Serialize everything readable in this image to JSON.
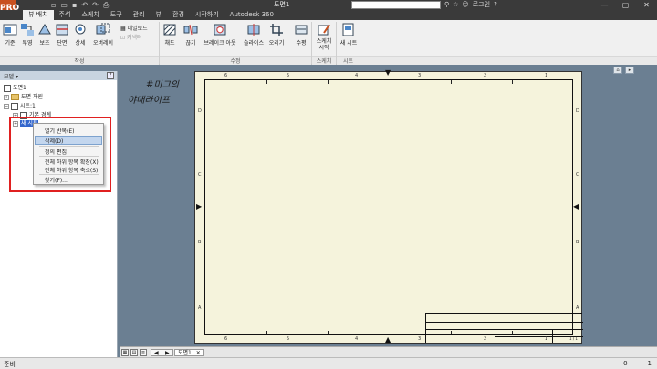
{
  "titlebar": {
    "app_logo": "PRO",
    "doc_title": "도면1",
    "signin": "로그인",
    "help": "?",
    "minimize": "—",
    "maximize": "▢",
    "close": "✕"
  },
  "tabs": [
    {
      "label": "뷰 배치",
      "active": true
    },
    {
      "label": "주석"
    },
    {
      "label": "스케치"
    },
    {
      "label": "도구"
    },
    {
      "label": "관리"
    },
    {
      "label": "뷰"
    },
    {
      "label": "환경"
    },
    {
      "label": "시작하기"
    },
    {
      "label": "Autodesk 360"
    }
  ],
  "ribbon": {
    "create": {
      "label": "작성",
      "buttons": [
        "기준",
        "투영",
        "보조",
        "단면",
        "상세",
        "오버레이"
      ],
      "small": [
        {
          "label": "네일보드",
          "enabled": true
        },
        {
          "label": "커넥터",
          "enabled": false
        }
      ]
    },
    "modify": {
      "label": "수정",
      "buttons": [
        "채도",
        "끊기",
        "브레이크 아웃",
        "슬라이스",
        "오리기",
        "수평"
      ]
    },
    "sketch": {
      "label": "스케치",
      "button": "스케치 시작"
    },
    "sheets": {
      "label": "시트",
      "button": "새 시트"
    }
  },
  "browser": {
    "filter": "모델 ▾",
    "help": "?",
    "tree": {
      "root": "도면1",
      "resources": "도면 자원",
      "sheet": "시트:1",
      "border": "기본 경계",
      "selected": "새 시트"
    }
  },
  "context_menu": {
    "items": [
      "열기 반복(E)",
      "삭제(D)",
      "정의 편집",
      "전체 하위 항목 확장(X)",
      "전체 하위 항목 축소(S)",
      "찾기(F)..."
    ]
  },
  "watermark": {
    "line1": "#미그의",
    "line2": "야매라이프"
  },
  "sheet": {
    "top_zones": [
      "6",
      "5",
      "4",
      "3",
      "2",
      "1"
    ],
    "side_zones": [
      "D",
      "C",
      "B",
      "A"
    ],
    "title_block_text": [
      "1 / 1"
    ]
  },
  "bottom": {
    "nav_labels": [
      "◀",
      "▶"
    ],
    "model_tab": "도면1",
    "model_close": "✕"
  },
  "status": {
    "text": "준비",
    "num1": "0",
    "num2": "1"
  }
}
